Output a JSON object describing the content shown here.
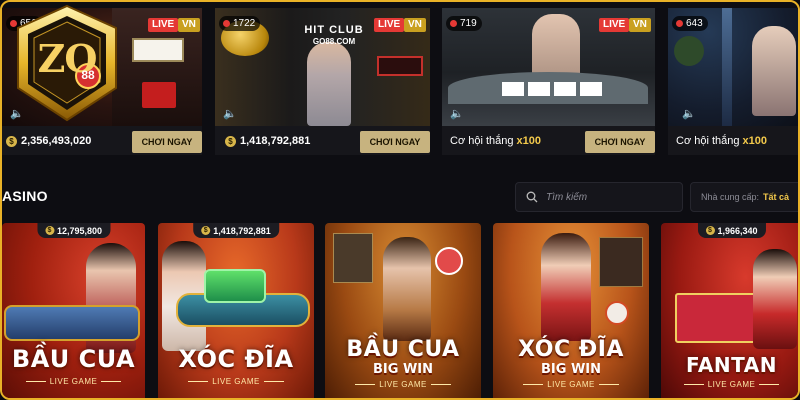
{
  "logo": {
    "text": "ZO",
    "subtext": "88"
  },
  "live_tables": [
    {
      "viewers": "656",
      "live": "LIVE",
      "lang": "VN",
      "footer_amount": "2,356,493,020",
      "button": "CHƠI NGAY"
    },
    {
      "viewers": "1722",
      "live": "LIVE",
      "lang": "VN",
      "sign_line1": "HIT CLUB",
      "sign_line2": "GO88.COM",
      "footer_amount": "1,418,792,881",
      "button": "CHƠI NGAY"
    },
    {
      "viewers": "719",
      "live": "LIVE",
      "lang": "VN",
      "footer_text": "Cơ hội thắng",
      "footer_multiplier": "x100",
      "button": "CHƠI NGAY"
    },
    {
      "viewers": "643",
      "footer_text": "Cơ hội thắng",
      "footer_multiplier": "x100"
    }
  ],
  "section": {
    "title": "ASINO"
  },
  "search": {
    "placeholder": "Tìm kiếm"
  },
  "provider": {
    "label": "Nhà cung cấp:",
    "value": "Tất cả"
  },
  "games": [
    {
      "jackpot": "12,795,800",
      "title": "BẦU CUA",
      "tag": "LIVE GAME"
    },
    {
      "jackpot": "1,418,792,881",
      "title": "XÓC ĐĨA",
      "tag": "LIVE GAME"
    },
    {
      "title": "BẦU CUA",
      "sub": "BIG WIN",
      "tag": "LIVE GAME"
    },
    {
      "title": "XÓC ĐĨA",
      "sub": "BIG WIN",
      "tag": "LIVE GAME"
    },
    {
      "jackpot": "1,966,340",
      "title": "FANTAN",
      "tag": "LIVE GAME"
    }
  ],
  "colors": {
    "accent": "#e9b227",
    "live_red": "#e53935",
    "gold": "#f3c94b",
    "button": "#c7b37f"
  }
}
